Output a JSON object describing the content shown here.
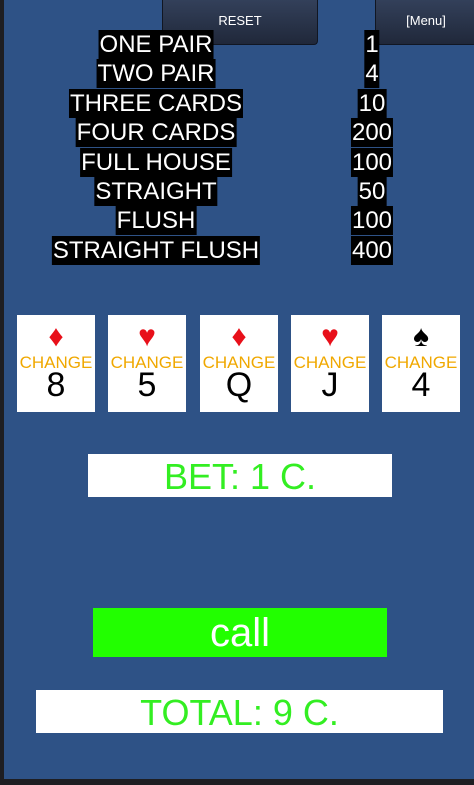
{
  "header": {
    "reset_label": "RESET",
    "menu_label": "[Menu]"
  },
  "paytable": [
    {
      "hand": "ONE PAIR",
      "payout": "1"
    },
    {
      "hand": "TWO PAIR",
      "payout": "4"
    },
    {
      "hand": "THREE CARDS",
      "payout": "10"
    },
    {
      "hand": "FOUR CARDS",
      "payout": "200"
    },
    {
      "hand": "FULL HOUSE",
      "payout": "100"
    },
    {
      "hand": "STRAIGHT",
      "payout": "50"
    },
    {
      "hand": "FLUSH",
      "payout": "100"
    },
    {
      "hand": "STRAIGHT FLUSH",
      "payout": "400"
    }
  ],
  "cards": [
    {
      "suit": "♦",
      "suit_name": "diamond",
      "color": "red",
      "change_label": "CHANGE",
      "rank": "8"
    },
    {
      "suit": "♥",
      "suit_name": "heart",
      "color": "red",
      "change_label": "CHANGE",
      "rank": "5"
    },
    {
      "suit": "♦",
      "suit_name": "diamond",
      "color": "red",
      "change_label": "CHANGE",
      "rank": "Q"
    },
    {
      "suit": "♥",
      "suit_name": "heart",
      "color": "red",
      "change_label": "CHANGE",
      "rank": "J"
    },
    {
      "suit": "♠",
      "suit_name": "spade",
      "color": "black",
      "change_label": "CHANGE",
      "rank": "4"
    }
  ],
  "bet_text": "BET: 1 C.",
  "call_label": "call",
  "total_text": "TOTAL: 9 C.",
  "colors": {
    "background": "#2e5286",
    "green_text": "#33ee22",
    "call_button": "#22ff00",
    "change_text": "#f0a800",
    "red_suit": "#e8101a"
  }
}
